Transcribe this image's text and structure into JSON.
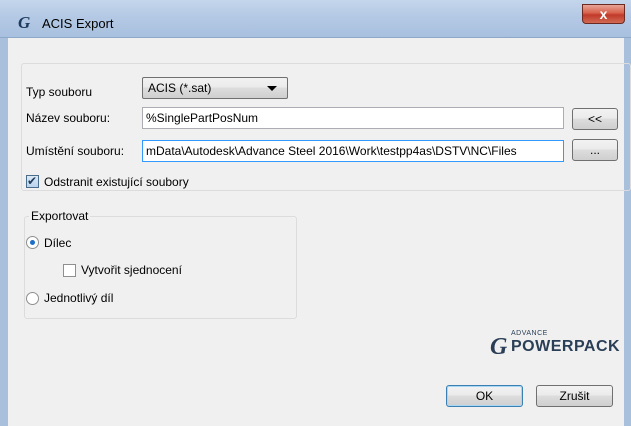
{
  "window": {
    "title": "ACIS Export",
    "app_icon": "G",
    "close_icon": "x"
  },
  "form": {
    "file_type_label": "Typ souboru",
    "file_type_value": "ACIS (*.sat)",
    "file_name_label": "Název souboru:",
    "file_name_value": "%SinglePartPosNum",
    "file_name_button": "<<",
    "file_location_label": "Umístění souboru:",
    "file_location_value": "mData\\Autodesk\\Advance Steel 2016\\Work\\testpp4as\\DSTV\\NC\\Files",
    "browse_button": "...",
    "delete_existing_label": "Odstranit existující soubory",
    "delete_existing_checked": true
  },
  "export_group": {
    "title": "Exportovat",
    "option_part": "Dílec",
    "option_part_selected": true,
    "create_union_label": "Vytvořit sjednocení",
    "create_union_checked": false,
    "option_single": "Jednotlivý díl",
    "option_single_selected": false
  },
  "logo": {
    "small": "ADVANCE",
    "big": "POWERPACK",
    "mark": "G"
  },
  "buttons": {
    "ok": "OK",
    "cancel": "Zrušit"
  }
}
